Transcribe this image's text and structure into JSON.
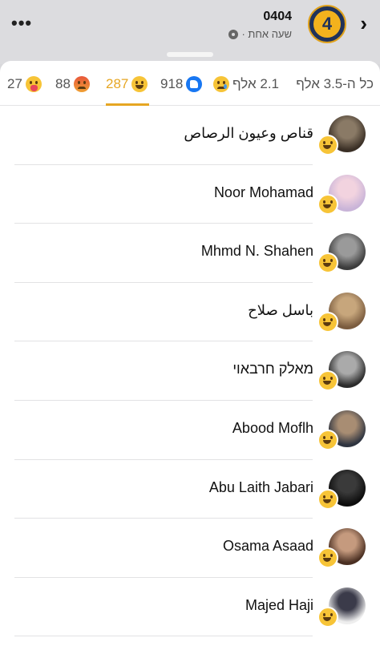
{
  "post_header": {
    "more_label": "•••",
    "page_name": "0404",
    "meta_text": "שעה אחת ·",
    "avatar_label": "4"
  },
  "tabs": [
    {
      "label": "כל ה-3.5 אלף",
      "icon": null,
      "active": false
    },
    {
      "label": "2.1 אלף",
      "icon": "sad-emoji-icon",
      "active": false
    },
    {
      "label": "918",
      "icon": "like-icon",
      "active": false
    },
    {
      "label": "287",
      "icon": "haha-emoji-icon",
      "active": true
    },
    {
      "label": "88",
      "icon": "angry-emoji-icon",
      "active": false
    },
    {
      "label": "27",
      "icon": "care-emoji-icon",
      "active": false
    }
  ],
  "reactors": [
    {
      "name": "قناص وعيون الرصاص",
      "reaction": "haha-emoji-icon",
      "avatar_colors": [
        "#3a2f25",
        "#8a7a66"
      ]
    },
    {
      "name": "Noor Mohamad",
      "reaction": "haha-emoji-icon",
      "avatar_colors": [
        "#c9b4d8",
        "#f2d3df"
      ]
    },
    {
      "name": "Mhmd N. Shahen",
      "reaction": "haha-emoji-icon",
      "avatar_colors": [
        "#3c3c3c",
        "#9a9a9a"
      ]
    },
    {
      "name": "باسل صلاح",
      "reaction": "haha-emoji-icon",
      "avatar_colors": [
        "#7b5c3f",
        "#c7a67c"
      ]
    },
    {
      "name": "מאלק חרבאוי",
      "reaction": "haha-emoji-icon",
      "avatar_colors": [
        "#2b2b2b",
        "#aaaaaa"
      ]
    },
    {
      "name": "Abood Moflh",
      "reaction": "haha-emoji-icon",
      "avatar_colors": [
        "#2e3440",
        "#a88d73"
      ]
    },
    {
      "name": "Abu Laith Jabari",
      "reaction": "haha-emoji-icon",
      "avatar_colors": [
        "#0d0d0d",
        "#3a3a3a"
      ]
    },
    {
      "name": "Osama Asaad",
      "reaction": "haha-emoji-icon",
      "avatar_colors": [
        "#4a2f22",
        "#c59a7e"
      ]
    },
    {
      "name": "Majed Haji",
      "reaction": "haha-emoji-icon",
      "avatar_colors": [
        "#eeeeee",
        "#3b3b4a"
      ]
    }
  ],
  "colors": {
    "accent": "#e6a623",
    "like_blue": "#1877f2",
    "haha_yellow": "#f7c437"
  }
}
